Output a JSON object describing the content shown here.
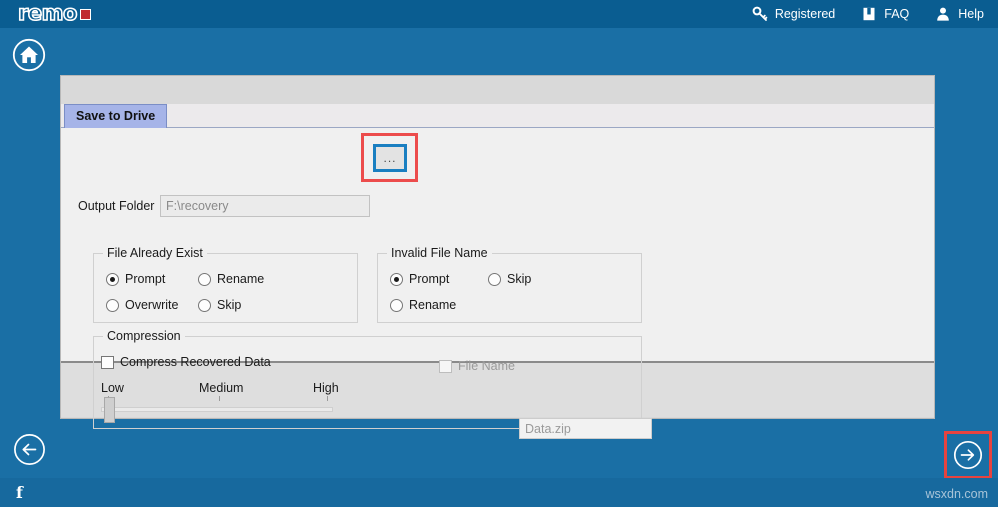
{
  "app": {
    "logo_text": "remo",
    "accent_blue": "#1a6fa5",
    "header_blue": "#0a5d91",
    "annotation_red": "#ec4c4c",
    "focus_blue": "#1a7fc1"
  },
  "topnav": {
    "items": [
      {
        "label": "Registered",
        "icon": "key-icon"
      },
      {
        "label": "FAQ",
        "icon": "book-icon"
      },
      {
        "label": "Help",
        "icon": "person-icon"
      }
    ]
  },
  "home": {
    "icon": "home-icon"
  },
  "panel": {
    "tabs": [
      {
        "label": "Save to Drive",
        "active": true
      }
    ]
  },
  "output": {
    "label": "Output Folder",
    "value": "F:\\recovery",
    "browse_label": "...",
    "browse_icon": "ellipsis-icon"
  },
  "file_exists": {
    "title": "File Already Exist",
    "options": [
      {
        "label": "Prompt",
        "checked": true
      },
      {
        "label": "Rename",
        "checked": false
      },
      {
        "label": "Overwrite",
        "checked": false
      },
      {
        "label": "Skip",
        "checked": false
      }
    ]
  },
  "invalid_name": {
    "title": "Invalid File Name",
    "options": [
      {
        "label": "Prompt",
        "checked": true
      },
      {
        "label": "Skip",
        "checked": false
      },
      {
        "label": "Rename",
        "checked": false
      }
    ]
  },
  "compression": {
    "title": "Compression",
    "compress_label": "Compress Recovered Data",
    "compress_checked": false,
    "filename_label": "File Name",
    "filename_checked": false,
    "filename_value": "Data.zip",
    "slider": {
      "low_label": "Low",
      "medium_label": "Medium",
      "high_label": "High",
      "value": 0,
      "min": 0,
      "max": 100
    }
  },
  "nav": {
    "back_icon": "arrow-left-circle-icon",
    "next_icon": "arrow-right-circle-icon"
  },
  "footer": {
    "facebook_label": "f",
    "watermark": "wsxdn.com"
  }
}
